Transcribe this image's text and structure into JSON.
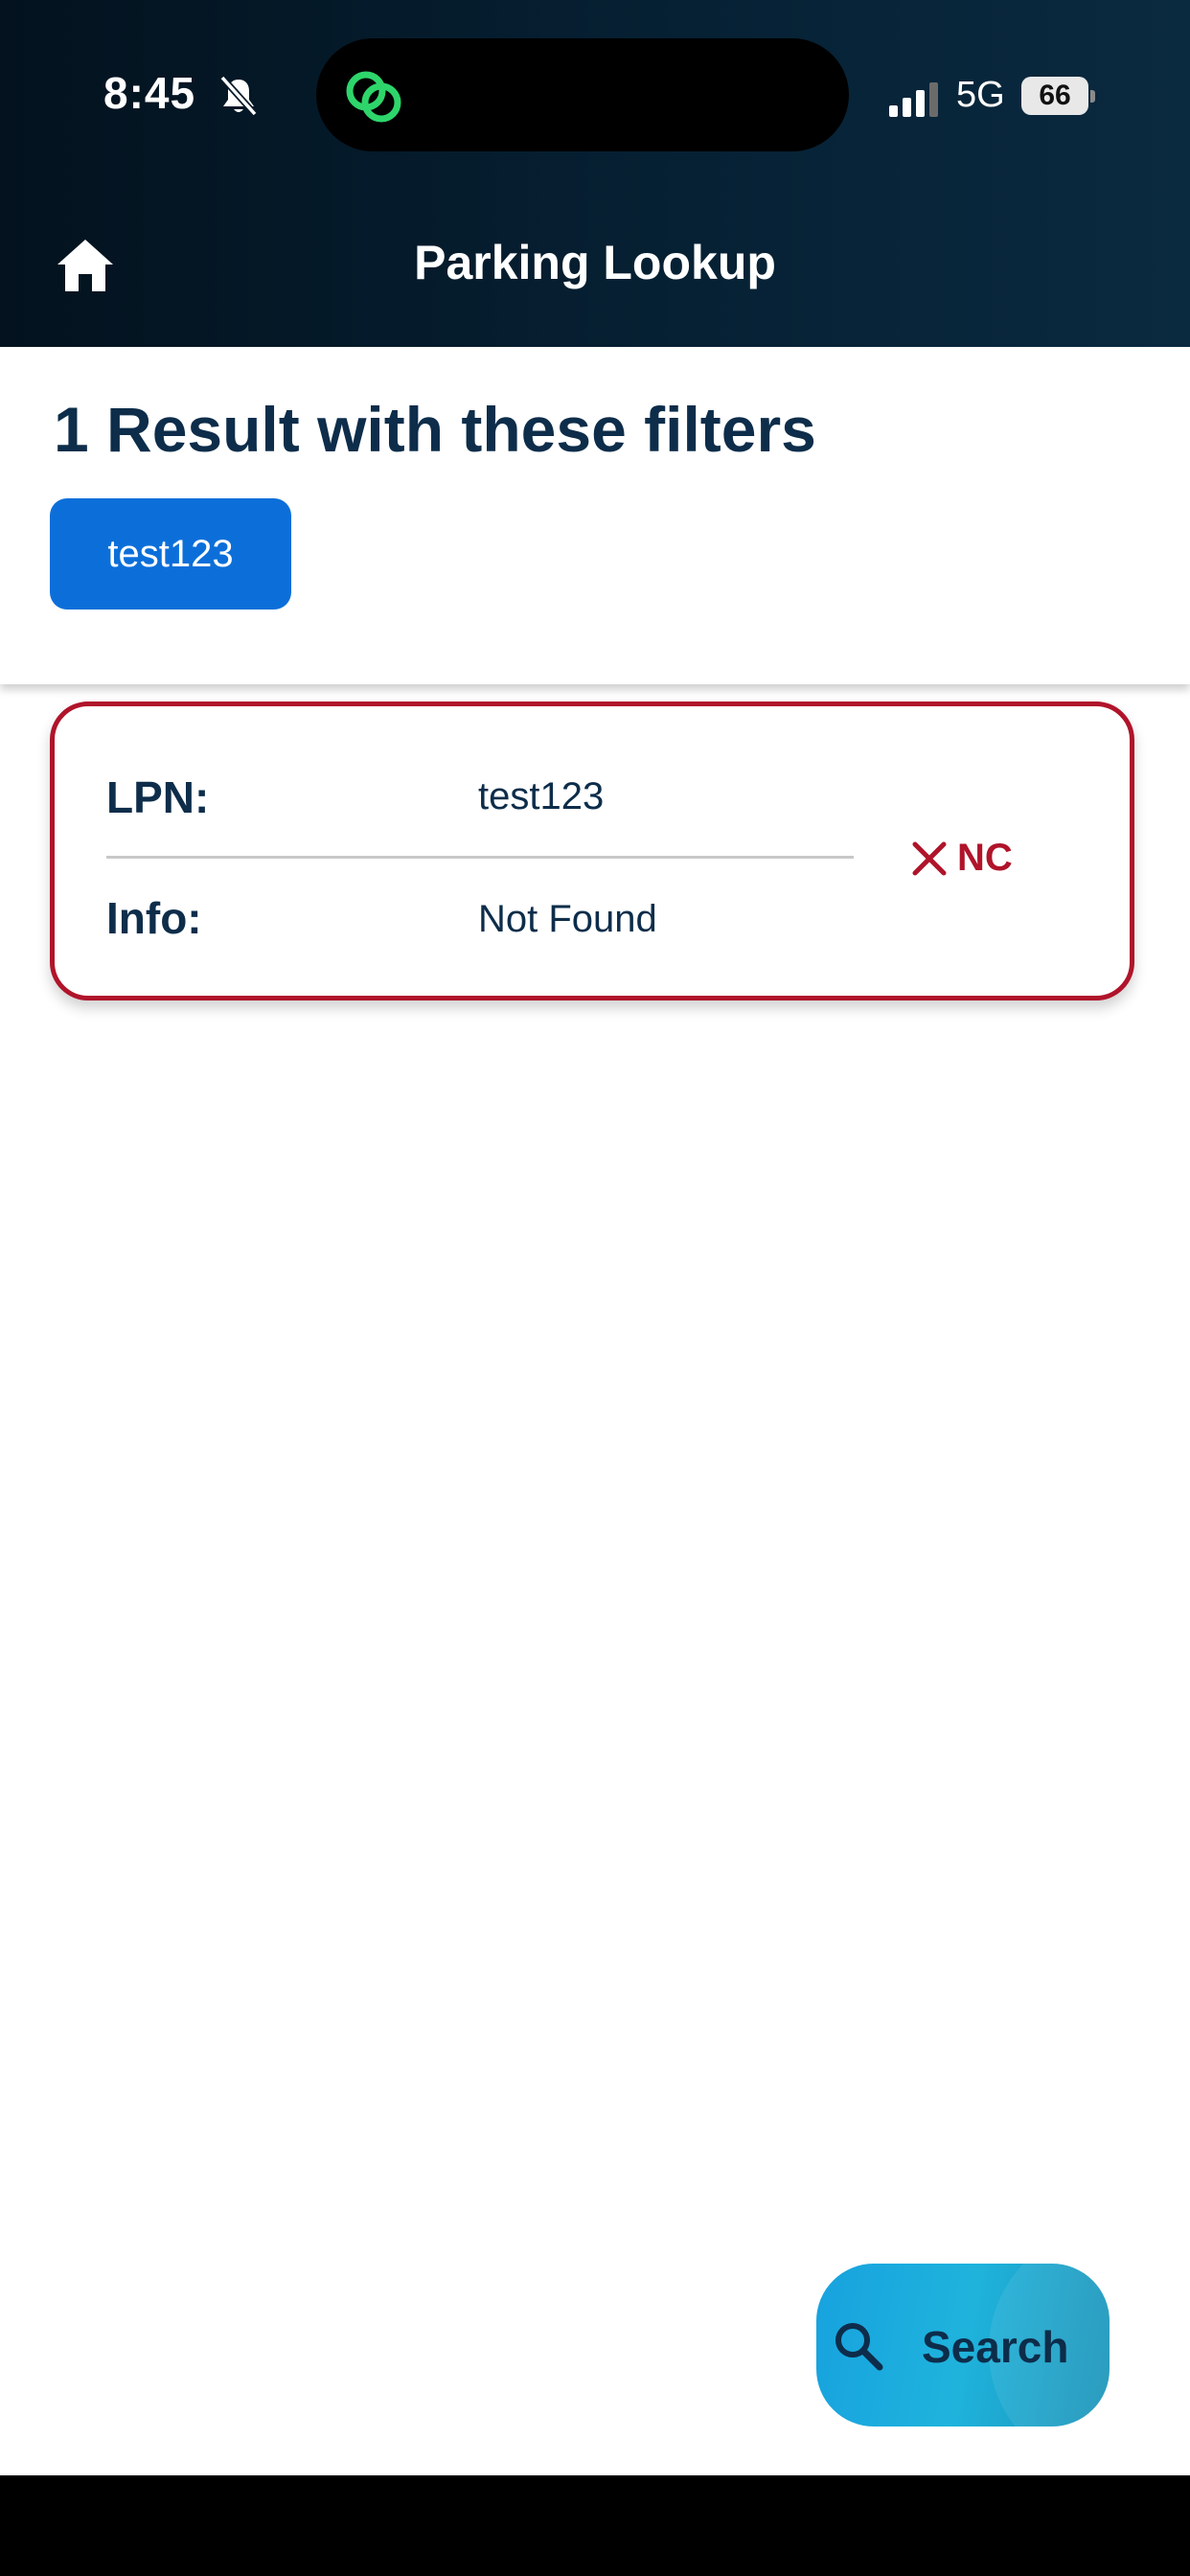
{
  "status_bar": {
    "time": "8:45",
    "network": "5G",
    "battery": "66"
  },
  "header": {
    "title": "Parking Lookup"
  },
  "filters": {
    "heading": "1 Result with these filters",
    "chips": [
      "test123"
    ]
  },
  "results": [
    {
      "lpn_label": "LPN:",
      "lpn_value": "test123",
      "info_label": "Info:",
      "info_value": "Not Found",
      "status": "NC"
    }
  ],
  "search_button": {
    "label": "Search"
  },
  "colors": {
    "header_bg": "#062033",
    "heading_text": "#0d2d4a",
    "chip_bg": "#0c6fd9",
    "alert_red": "#b0142a",
    "fab_bg": "#1fb3dc"
  },
  "icons": {
    "status": [
      "bell-slash-icon",
      "app-link-icon",
      "cellular-signal-icon",
      "battery-icon"
    ],
    "nav": "home-icon",
    "result_status": "x-mark-icon",
    "fab": "search-icon"
  }
}
